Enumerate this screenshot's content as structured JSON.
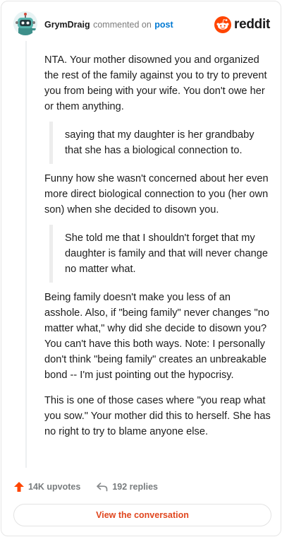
{
  "header": {
    "author": "GrymDraig",
    "action_text": "commented on",
    "post_link": "post",
    "brand_name": "reddit",
    "brand_color": "#ff4500",
    "avatar_icon": "robot-snoo-avatar"
  },
  "comment": {
    "paragraphs": [
      "NTA. Your mother disowned you and organized the rest of the family against you to try to prevent you from being with your wife. You don't owe her or them anything.",
      "Funny how she wasn't concerned about her even more direct biological connection to you (her own son) when she decided to disown you.",
      "Being family doesn't make you less of an asshole. Also, if \"being family\" never changes \"no matter what,\" why did she decide to disown you? You can't have this both ways. Note: I personally don't think \"being family\" creates an unbreakable bond -- I'm just pointing out the hypocrisy.",
      "This is one of those cases where \"you reap what you sow.\" Your mother did this to herself. She has no right to try to blame anyone else."
    ],
    "quotes": [
      "saying that my daughter is her grandbaby that she has a biological connection to.",
      "She told me that I shouldn't forget that my daughter is family and that will never change no matter what."
    ]
  },
  "footer": {
    "upvotes_label": "14K upvotes",
    "replies_label": "192 replies",
    "view_button": "View the conversation",
    "accent_color": "#e0461e"
  }
}
